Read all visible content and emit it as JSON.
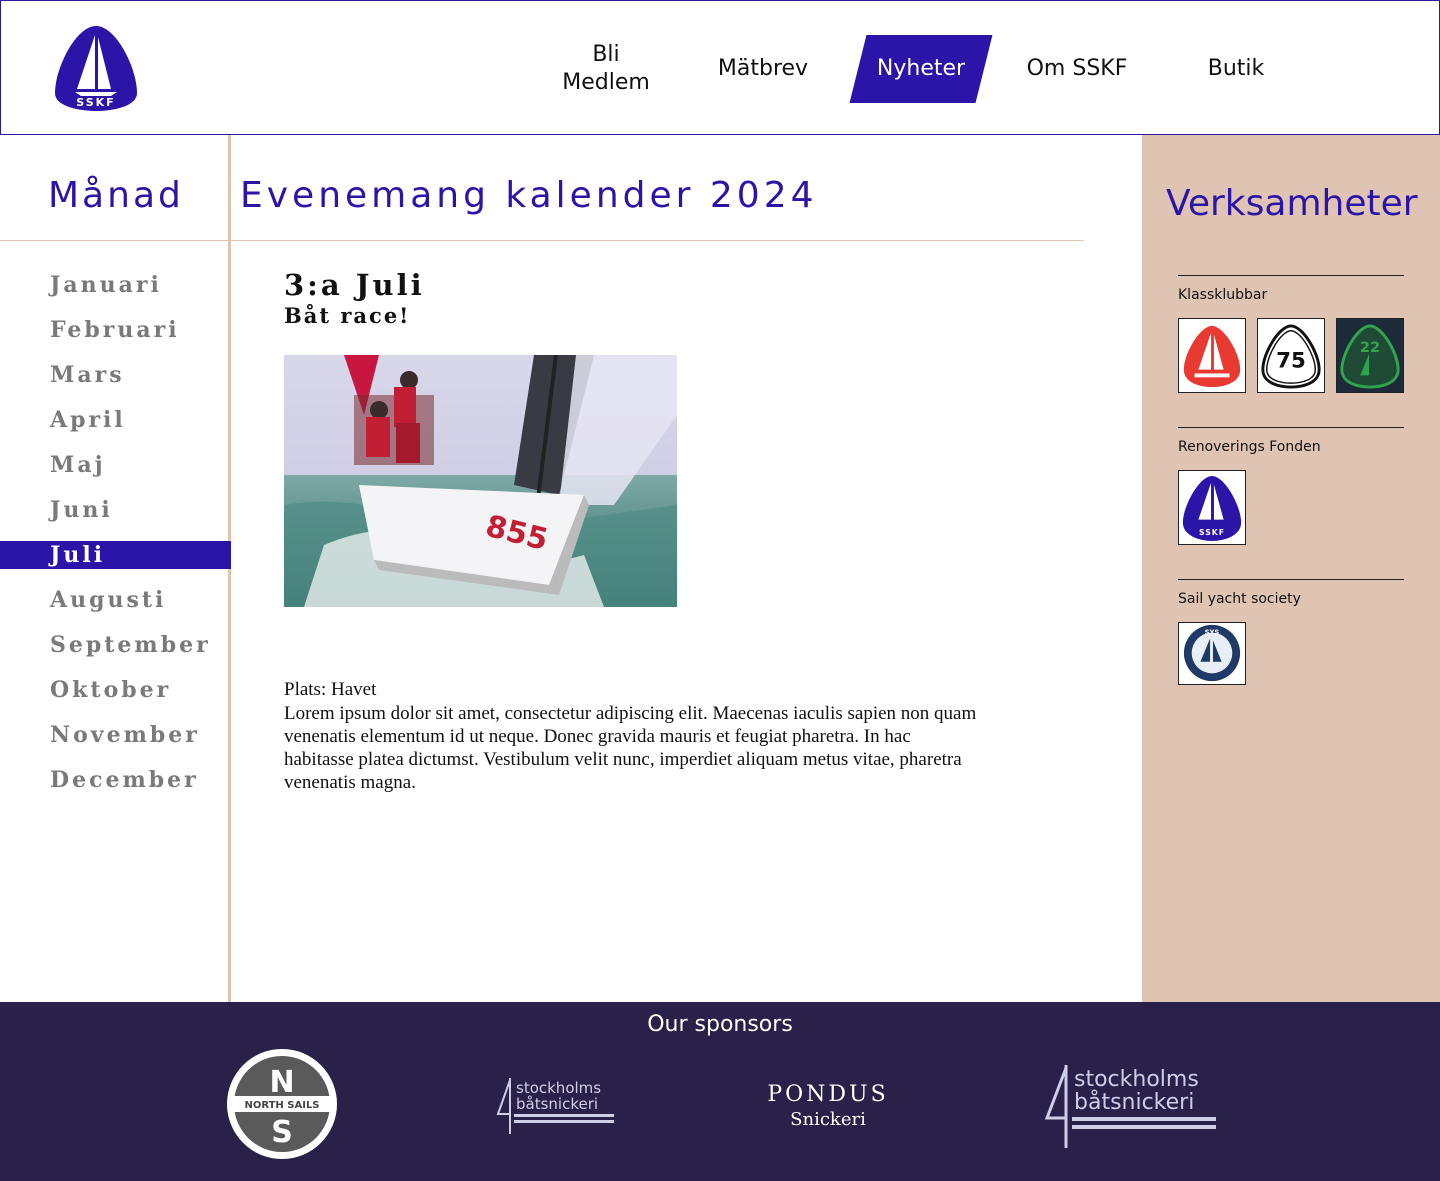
{
  "header": {
    "logo_text": "SSKF",
    "nav": [
      {
        "label": "Bli\nMedlem"
      },
      {
        "label": "Mätbrev"
      },
      {
        "label": "Nyheter"
      },
      {
        "label": "Om SSKF"
      },
      {
        "label": "Butik"
      }
    ],
    "active_nav": "Nyheter"
  },
  "months": {
    "heading": "Månad",
    "items": [
      "Januari",
      "Februari",
      "Mars",
      "April",
      "Maj",
      "Juni",
      "Juli",
      "Augusti",
      "September",
      "Oktober",
      "November",
      "December"
    ],
    "active": "Juli"
  },
  "calendar": {
    "title": "Evenemang kalender 2024"
  },
  "event": {
    "date": "3:a Juli",
    "subtitle": "Båt race!",
    "image_alt": "sailboat-racing-photo",
    "boat_number": "855",
    "place": "Plats: Havet",
    "description": "Lorem ipsum dolor sit amet, consectetur adipiscing elit. Maecenas iaculis sapien non quam venenatis elementum id ut neque. Donec gravida mauris et feugiat pharetra. In hac habitasse platea dictumst. Vestibulum velit nunc, imperdiet aliquam metus vitae, pharetra venenatis magna."
  },
  "sidebar": {
    "title": "Verksamheter",
    "sections": [
      {
        "label": "Klassklubbar",
        "badges": [
          "red-sail-badge",
          "75-klubben-badge",
          "green-22-badge"
        ],
        "badge_texts": [
          "",
          "75",
          "22"
        ]
      },
      {
        "label": "Renoverings Fonden",
        "badges": [
          "sskf-badge"
        ],
        "badge_texts": [
          "SSKF"
        ]
      },
      {
        "label": "Sail yacht society",
        "badges": [
          "sys-badge"
        ],
        "badge_texts": [
          "SYS"
        ]
      }
    ]
  },
  "footer": {
    "title": "Our sponsors",
    "sponsors": [
      {
        "name": "North Sails",
        "top": "N",
        "middle": "NORTH SAILS",
        "bottom": "S"
      },
      {
        "name": "Stockholms båtsnickeri",
        "line1": "stockholms",
        "line2": "båtsnickeri"
      },
      {
        "name": "Pondus Snickeri",
        "line1": "PONDUS",
        "line2": "Snickeri"
      },
      {
        "name": "Stockholms båtsnickeri",
        "line1": "stockholms",
        "line2": "båtsnickeri"
      }
    ]
  },
  "colors": {
    "brand": "#2b14a8",
    "sidebar_bg": "#e0c4b3",
    "footer_bg": "#29214a",
    "month_text": "#7a7a7a",
    "divider": "#e0c4b2"
  }
}
